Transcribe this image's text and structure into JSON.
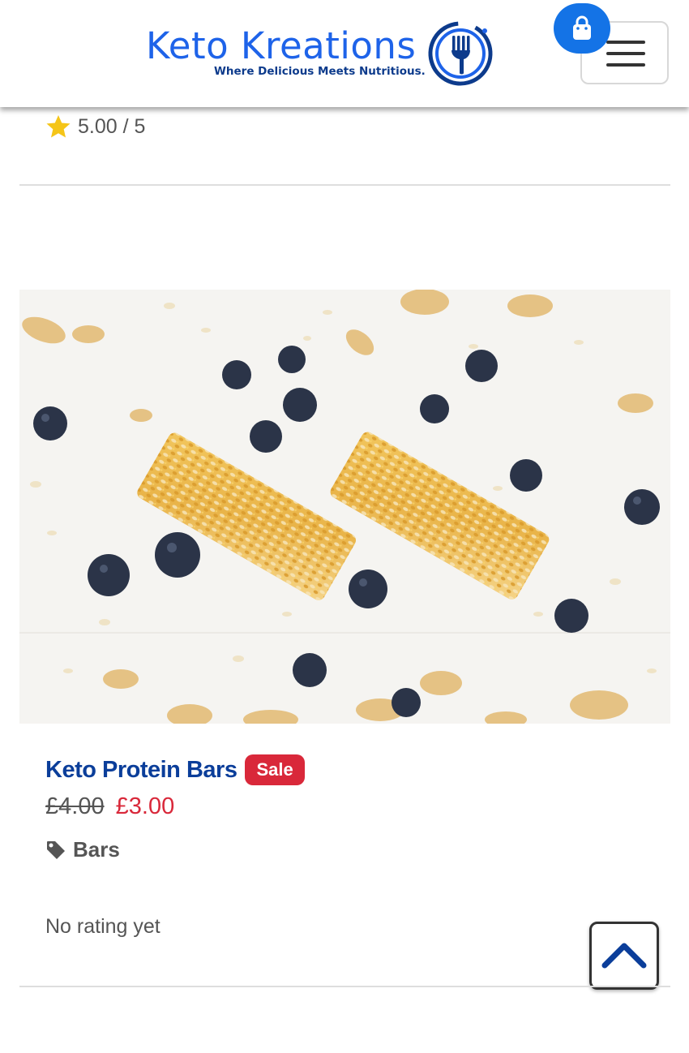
{
  "header": {
    "logo_title": "Keto Kreations",
    "logo_tagline": "Where Delicious Meets Nutritious.",
    "cart_icon": "shopping-bag-icon",
    "menu_icon": "hamburger-icon"
  },
  "previous_product": {
    "rating": "5.00 / 5"
  },
  "product": {
    "title": "Keto Protein Bars",
    "badge": "Sale",
    "old_price": "£4.00",
    "new_price": "£3.00",
    "category": "Bars",
    "rating_text": "No rating yet"
  },
  "colors": {
    "brand_blue": "#1e63e9",
    "title_blue": "#0b3e9a",
    "sale_red": "#d9283a",
    "star_yellow": "#f5c518",
    "cart_blue": "#1473e6"
  },
  "icons": {
    "rating": "star-icon",
    "category": "tag-icon",
    "scroll_top": "chevron-up-icon"
  }
}
